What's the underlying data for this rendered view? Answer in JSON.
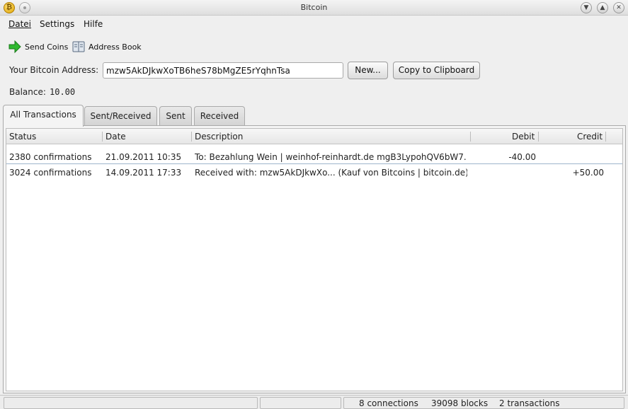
{
  "window": {
    "title": "Bitcoin"
  },
  "menu": {
    "file": "Datei",
    "settings": "Settings",
    "help": "Hilfe"
  },
  "toolbar": {
    "send_coins": "Send Coins",
    "address_book": "Address Book"
  },
  "address": {
    "label": "Your Bitcoin Address:",
    "value": "mzw5AkDJkwXoTB6heS78bMgZE5rYqhnTsa",
    "new_button": "New...",
    "copy_button": "Copy to Clipboard"
  },
  "balance": {
    "label": "Balance:",
    "value": "10.00"
  },
  "tabs": [
    "All Transactions",
    "Sent/Received",
    "Sent",
    "Received"
  ],
  "columns": [
    "Status",
    "Date",
    "Description",
    "Debit",
    "Credit"
  ],
  "transactions": [
    {
      "status": "2380 confirmations",
      "date": "21.09.2011 10:35",
      "description": "To: Bezahlung Wein | weinhof-reinhardt.de mgB3LypohQV6bW7...",
      "debit": "-40.00",
      "credit": ""
    },
    {
      "status": "3024 confirmations",
      "date": "14.09.2011 17:33",
      "description": "Received with: mzw5AkDJkwXo... (Kauf von Bitcoins | bitcoin.de)",
      "debit": "",
      "credit": "+50.00"
    }
  ],
  "status_bar": {
    "connections": "8 connections",
    "blocks": "39098 blocks",
    "transactions": "2 transactions"
  },
  "colors": {
    "send_arrow": "#2fb82f",
    "selection_line": "#9fb5cc"
  }
}
